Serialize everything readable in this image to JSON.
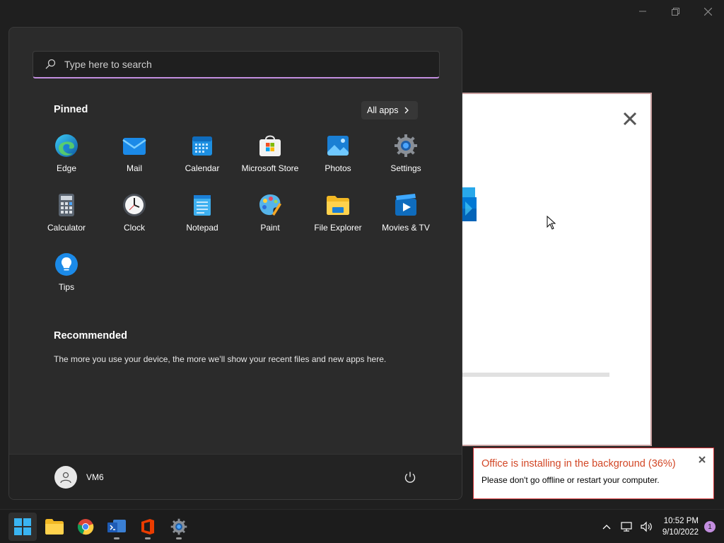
{
  "start_menu": {
    "search": {
      "placeholder": "Type here to search"
    },
    "pinned_title": "Pinned",
    "all_apps_label": "All apps",
    "pinned_apps": [
      {
        "label": "Edge",
        "icon": "edge-icon"
      },
      {
        "label": "Mail",
        "icon": "mail-icon"
      },
      {
        "label": "Calendar",
        "icon": "calendar-icon"
      },
      {
        "label": "Microsoft Store",
        "icon": "store-icon"
      },
      {
        "label": "Photos",
        "icon": "photos-icon"
      },
      {
        "label": "Settings",
        "icon": "settings-icon"
      },
      {
        "label": "Calculator",
        "icon": "calculator-icon"
      },
      {
        "label": "Clock",
        "icon": "clock-icon"
      },
      {
        "label": "Notepad",
        "icon": "notepad-icon"
      },
      {
        "label": "Paint",
        "icon": "paint-icon"
      },
      {
        "label": "File Explorer",
        "icon": "folder-icon"
      },
      {
        "label": "Movies & TV",
        "icon": "movies-icon"
      },
      {
        "label": "Tips",
        "icon": "tips-icon"
      }
    ],
    "recommended_title": "Recommended",
    "recommended_text": "The more you use your device, the more we’ll show your recent files and new apps here.",
    "user_name": "VM6"
  },
  "installer": {
    "progress_fraction": 0.36
  },
  "toast": {
    "title": "Office is installing in the background (36%)",
    "body": "Please don't go offline or restart your computer."
  },
  "taskbar": {
    "apps": [
      "start-icon",
      "file-explorer-icon",
      "chrome-icon",
      "teams-icon",
      "office-icon",
      "settings-icon"
    ],
    "time": "10:52 PM",
    "date": "9/10/2022",
    "notification_count": "1"
  },
  "colors": {
    "accent": "#c38ee0",
    "toast_title": "#d24726",
    "start_bg": "#2b2b2b",
    "taskbar_bg": "#1c1c1c"
  }
}
